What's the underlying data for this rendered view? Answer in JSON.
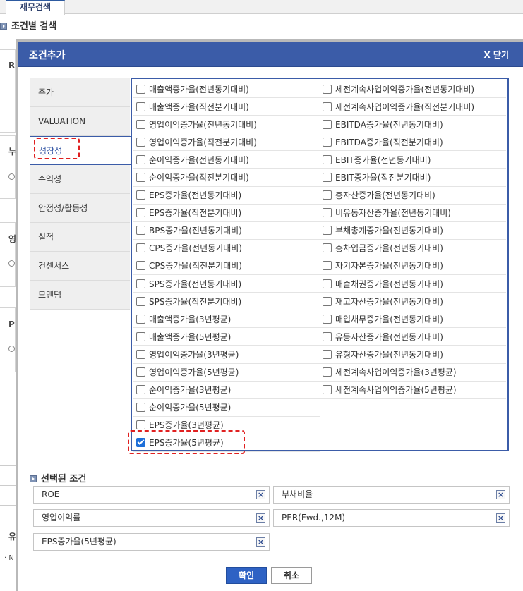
{
  "background": {
    "tab_label": "재무검색",
    "section_title": "조건별 검색",
    "panel_marks": [
      "R",
      "누",
      "영",
      "P"
    ],
    "bottom_mark": "유",
    "bottom_note": "· N"
  },
  "modal": {
    "title": "조건추가",
    "close_label": "X 닫기",
    "categories": [
      {
        "label": "주가"
      },
      {
        "label": "VALUATION"
      },
      {
        "label": "성장성"
      },
      {
        "label": "수익성"
      },
      {
        "label": "안정성/활동성"
      },
      {
        "label": "실적"
      },
      {
        "label": "컨센서스"
      },
      {
        "label": "모멘텀"
      }
    ],
    "active_category": "성장성",
    "left_options": [
      {
        "label": "매출액증가율(전년동기대비)",
        "checked": false
      },
      {
        "label": "매출액증가율(직전분기대비)",
        "checked": false
      },
      {
        "label": "영업이익증가율(전년동기대비)",
        "checked": false
      },
      {
        "label": "영업이익증가율(직전분기대비)",
        "checked": false
      },
      {
        "label": "순이익증가율(전년동기대비)",
        "checked": false
      },
      {
        "label": "순이익증가율(직전분기대비)",
        "checked": false
      },
      {
        "label": "EPS증가율(전년동기대비)",
        "checked": false
      },
      {
        "label": "EPS증가율(직전분기대비)",
        "checked": false
      },
      {
        "label": "BPS증가율(전년동기대비)",
        "checked": false
      },
      {
        "label": "CPS증가율(전년동기대비)",
        "checked": false
      },
      {
        "label": "CPS증가율(직전분기대비)",
        "checked": false
      },
      {
        "label": "SPS증가율(전년동기대비)",
        "checked": false
      },
      {
        "label": "SPS증가율(직전분기대비)",
        "checked": false
      },
      {
        "label": "매출액증가율(3년평균)",
        "checked": false
      },
      {
        "label": "매출액증가율(5년평균)",
        "checked": false
      },
      {
        "label": "영업이익증가율(3년평균)",
        "checked": false
      },
      {
        "label": "영업이익증가율(5년평균)",
        "checked": false
      },
      {
        "label": "순이익증가율(3년평균)",
        "checked": false
      },
      {
        "label": "순이익증가율(5년평균)",
        "checked": false
      },
      {
        "label": "EPS증가율(3년평균)",
        "checked": false
      },
      {
        "label": "EPS증가율(5년평균)",
        "checked": true
      }
    ],
    "right_options": [
      {
        "label": "세전계속사업이익증가율(전년동기대비)",
        "checked": false
      },
      {
        "label": "세전계속사업이익증가율(직전분기대비)",
        "checked": false
      },
      {
        "label": "EBITDA증가율(전년동기대비)",
        "checked": false
      },
      {
        "label": "EBITDA증가율(직전분기대비)",
        "checked": false
      },
      {
        "label": "EBIT증가율(전년동기대비)",
        "checked": false
      },
      {
        "label": "EBIT증가율(직전분기대비)",
        "checked": false
      },
      {
        "label": "총자산증가율(전년동기대비)",
        "checked": false
      },
      {
        "label": "비유동자산증가율(전년동기대비)",
        "checked": false
      },
      {
        "label": "부채총계증가율(전년동기대비)",
        "checked": false
      },
      {
        "label": "총차입금증가율(전년동기대비)",
        "checked": false
      },
      {
        "label": "자기자본증가율(전년동기대비)",
        "checked": false
      },
      {
        "label": "매출채권증가율(전년동기대비)",
        "checked": false
      },
      {
        "label": "재고자산증가율(전년동기대비)",
        "checked": false
      },
      {
        "label": "매입채무증가율(전년동기대비)",
        "checked": false
      },
      {
        "label": "유동자산증가율(전년동기대비)",
        "checked": false
      },
      {
        "label": "유형자산증가율(전년동기대비)",
        "checked": false
      },
      {
        "label": "세전계속사업이익증가율(3년평균)",
        "checked": false
      },
      {
        "label": "세전계속사업이익증가율(5년평균)",
        "checked": false
      }
    ],
    "selected_title": "선택된 조건",
    "selected_conditions": [
      "ROE",
      "부채비율",
      "영업이익률",
      "PER(Fwd.,12M)",
      "EPS증가율(5년평균)"
    ],
    "remove_glyph": "×",
    "confirm_label": "확인",
    "cancel_label": "취소",
    "colors": {
      "header": "#3b5ca8",
      "confirm": "#2e62c4",
      "highlight": "#e02020",
      "checked": "#1e6fd9"
    }
  }
}
